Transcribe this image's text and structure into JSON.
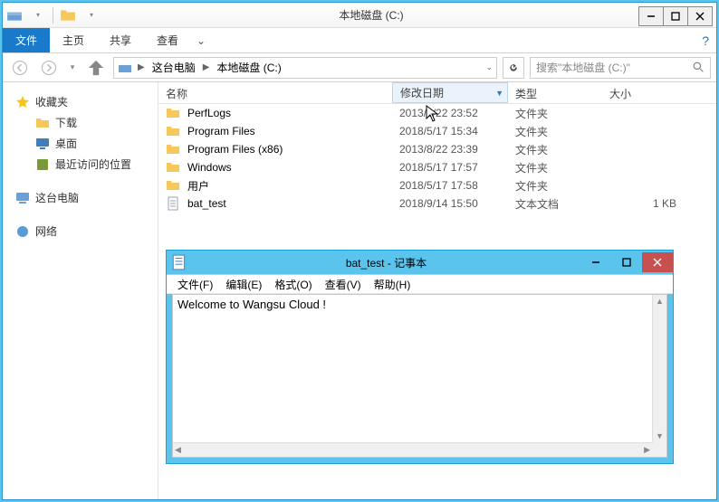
{
  "explorer": {
    "title": "本地磁盘 (C:)",
    "ribbon": {
      "file": "文件",
      "home": "主页",
      "share": "共享",
      "view": "查看"
    },
    "breadcrumb": {
      "root": "这台电脑",
      "loc": "本地磁盘 (C:)"
    },
    "search": {
      "placeholder": "搜索\"本地磁盘 (C:)\""
    },
    "columns": {
      "name": "名称",
      "date": "修改日期",
      "type": "类型",
      "size": "大小"
    },
    "rows": [
      {
        "icon": "folder",
        "name": "PerfLogs",
        "date": "2013/8/22 23:52",
        "type": "文件夹",
        "size": ""
      },
      {
        "icon": "folder",
        "name": "Program Files",
        "date": "2018/5/17 15:34",
        "type": "文件夹",
        "size": ""
      },
      {
        "icon": "folder",
        "name": "Program Files (x86)",
        "date": "2013/8/22 23:39",
        "type": "文件夹",
        "size": ""
      },
      {
        "icon": "folder",
        "name": "Windows",
        "date": "2018/5/17 17:57",
        "type": "文件夹",
        "size": ""
      },
      {
        "icon": "folder",
        "name": "用户",
        "date": "2018/5/17 17:58",
        "type": "文件夹",
        "size": ""
      },
      {
        "icon": "text",
        "name": "bat_test",
        "date": "2018/9/14 15:50",
        "type": "文本文档",
        "size": "1 KB"
      }
    ]
  },
  "nav": {
    "favorites": "收藏夹",
    "downloads": "下载",
    "desktop": "桌面",
    "recent": "最近访问的位置",
    "thispc": "这台电脑",
    "network": "网络"
  },
  "notepad": {
    "title": "bat_test - 记事本",
    "menu": {
      "file": "文件(F)",
      "edit": "编辑(E)",
      "format": "格式(O)",
      "view": "查看(V)",
      "help": "帮助(H)"
    },
    "content": "Welcome to Wangsu Cloud !"
  }
}
